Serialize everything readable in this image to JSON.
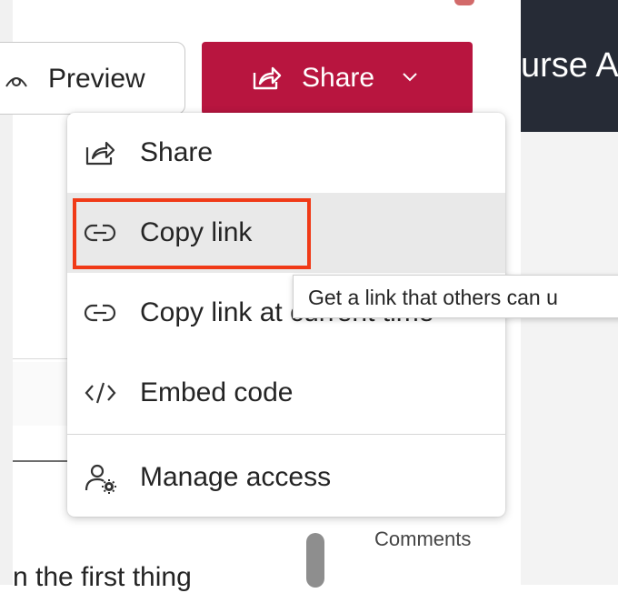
{
  "header": {
    "preview_label": "Preview",
    "share_label": "Share",
    "right_title_fragment": "urse A"
  },
  "menu": {
    "items": [
      {
        "label": "Share",
        "icon": "share-icon"
      },
      {
        "label": "Copy link",
        "icon": "link-icon"
      },
      {
        "label": "Copy link at current time",
        "icon": "link-icon"
      },
      {
        "label": "Embed code",
        "icon": "embed-code-icon"
      },
      {
        "label": "Manage access",
        "icon": "manage-access-icon"
      }
    ]
  },
  "tooltip": {
    "text": "Get a link that others can u"
  },
  "comments_label": "Comments",
  "bottom_text": "n the first thing",
  "colors": {
    "share_button": "#b8153f",
    "highlight": "#f03a17",
    "header_dark": "#262b36"
  }
}
